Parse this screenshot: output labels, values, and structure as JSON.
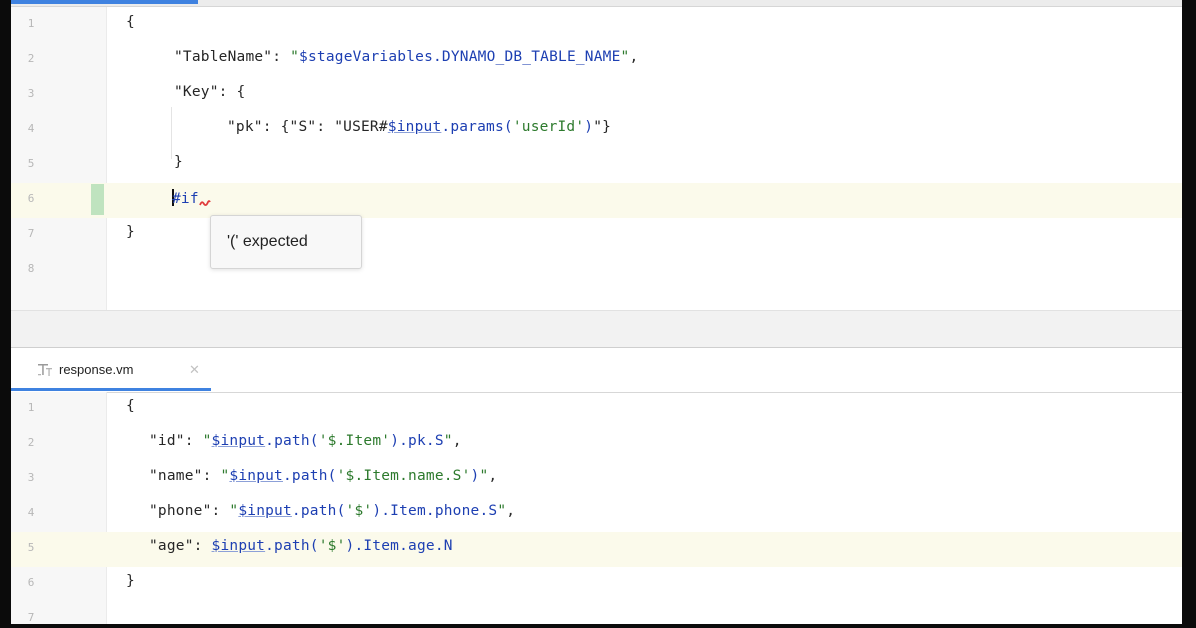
{
  "editor_top": {
    "lines": [
      {
        "n": "1",
        "tokens": [
          {
            "t": "{",
            "c": "punc"
          }
        ]
      },
      {
        "n": "2",
        "tokens": [
          {
            "t": "\"TableName\"",
            "c": "key"
          },
          {
            "t": ": ",
            "c": "punc"
          },
          {
            "t": "\"",
            "c": "str"
          },
          {
            "t": "$stageVariables",
            "c": "var"
          },
          {
            "t": ".DYNAMO_DB_TABLE_NAME",
            "c": "var"
          },
          {
            "t": "\"",
            "c": "str"
          },
          {
            "t": ",",
            "c": "punc"
          }
        ]
      },
      {
        "n": "3",
        "tokens": [
          {
            "t": "\"Key\"",
            "c": "key"
          },
          {
            "t": ": {",
            "c": "punc"
          }
        ]
      },
      {
        "n": "4",
        "tokens": [
          {
            "t": "\"pk\"",
            "c": "key"
          },
          {
            "t": ": {",
            "c": "punc"
          },
          {
            "t": "\"S\"",
            "c": "key"
          },
          {
            "t": ": ",
            "c": "punc"
          },
          {
            "t": "\"USER#",
            "c": "key"
          },
          {
            "t": "$input",
            "c": "var ul"
          },
          {
            "t": ".params(",
            "c": "var"
          },
          {
            "t": "'userId'",
            "c": "str"
          },
          {
            "t": ")",
            "c": "var"
          },
          {
            "t": "\"}",
            "c": "key"
          }
        ]
      },
      {
        "n": "5",
        "tokens": [
          {
            "t": "}",
            "c": "punc"
          }
        ]
      },
      {
        "n": "6",
        "tokens": [
          {
            "t": "#if",
            "c": "kw"
          }
        ]
      },
      {
        "n": "7",
        "tokens": [
          {
            "t": "}",
            "c": "punc"
          }
        ]
      },
      {
        "n": "8",
        "tokens": []
      }
    ],
    "tooltip": "'(' expected"
  },
  "editor_bottom": {
    "tab": {
      "label": "response.vm",
      "icon": "template-file-icon"
    },
    "lines": [
      {
        "n": "1",
        "tokens": [
          {
            "t": "{",
            "c": "punc"
          }
        ]
      },
      {
        "n": "2",
        "tokens": [
          {
            "t": "\"id\"",
            "c": "key"
          },
          {
            "t": ": ",
            "c": "punc"
          },
          {
            "t": "\"",
            "c": "str"
          },
          {
            "t": "$input",
            "c": "var ul"
          },
          {
            "t": ".path(",
            "c": "var"
          },
          {
            "t": "'$.Item'",
            "c": "str"
          },
          {
            "t": ").pk.S",
            "c": "var"
          },
          {
            "t": "\"",
            "c": "str"
          },
          {
            "t": ",",
            "c": "punc"
          }
        ]
      },
      {
        "n": "3",
        "tokens": [
          {
            "t": "\"name\"",
            "c": "key"
          },
          {
            "t": ": ",
            "c": "punc"
          },
          {
            "t": "\"",
            "c": "str"
          },
          {
            "t": "$input",
            "c": "var ul"
          },
          {
            "t": ".path(",
            "c": "var"
          },
          {
            "t": "'$.Item.name.S'",
            "c": "str"
          },
          {
            "t": ")",
            "c": "var"
          },
          {
            "t": "\"",
            "c": "str"
          },
          {
            "t": ",",
            "c": "punc"
          }
        ]
      },
      {
        "n": "4",
        "tokens": [
          {
            "t": "\"phone\"",
            "c": "key"
          },
          {
            "t": ": ",
            "c": "punc"
          },
          {
            "t": "\"",
            "c": "str"
          },
          {
            "t": "$input",
            "c": "var ul"
          },
          {
            "t": ".path(",
            "c": "var"
          },
          {
            "t": "'$'",
            "c": "str"
          },
          {
            "t": ").Item.phone.S",
            "c": "var"
          },
          {
            "t": "\"",
            "c": "str"
          },
          {
            "t": ",",
            "c": "punc"
          }
        ]
      },
      {
        "n": "5",
        "tokens": [
          {
            "t": "\"age\"",
            "c": "key"
          },
          {
            "t": ": ",
            "c": "punc"
          },
          {
            "t": "$input",
            "c": "var ul"
          },
          {
            "t": ".path(",
            "c": "var"
          },
          {
            "t": "'$'",
            "c": "str"
          },
          {
            "t": ").Item.age.N",
            "c": "var"
          }
        ]
      },
      {
        "n": "6",
        "tokens": [
          {
            "t": "}",
            "c": "punc"
          }
        ]
      },
      {
        "n": "7",
        "tokens": []
      }
    ]
  }
}
